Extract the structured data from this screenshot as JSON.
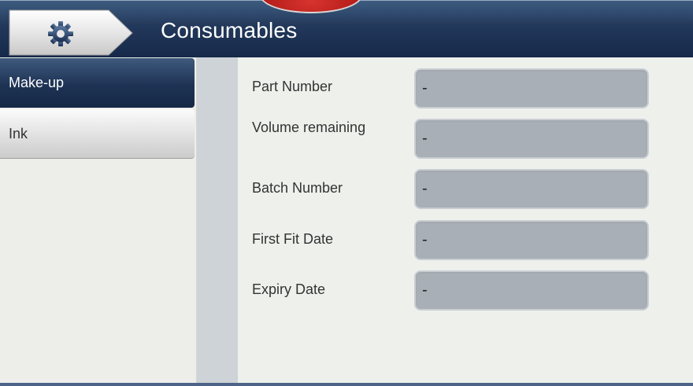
{
  "header": {
    "title": "Consumables",
    "settings_icon": "gear-icon"
  },
  "sidebar": {
    "items": [
      {
        "label": "Make-up",
        "active": true
      },
      {
        "label": "Ink",
        "active": false
      }
    ]
  },
  "fields": [
    {
      "label": "Part Number",
      "value": "-"
    },
    {
      "label": "Volume remaining",
      "value": "-"
    },
    {
      "label": "Batch Number",
      "value": "-"
    },
    {
      "label": "First Fit Date",
      "value": "-"
    },
    {
      "label": "Expiry Date",
      "value": "-"
    }
  ],
  "colors": {
    "header_dark": "#16294a",
    "active_tab": "#1e3354",
    "value_box": "#a9afb6",
    "alert_red": "#b31b18"
  }
}
